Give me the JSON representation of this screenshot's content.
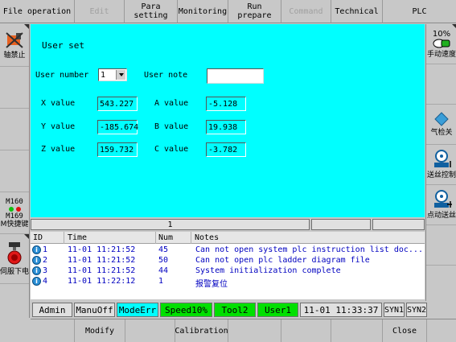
{
  "menu": {
    "file_operation": "File operation",
    "edit": "Edit",
    "para_setting_1": "Para",
    "para_setting_2": "setting",
    "monitoring": "Monitoring",
    "run_prepare": "Run prepare",
    "command": "Command",
    "technical": "Technical",
    "plc": "PLC"
  },
  "left_sidebar": {
    "axis_forbid": "轴禁止",
    "m160": "M160",
    "m169": "M169",
    "shortcut": "M快捷键",
    "servo_off": "伺服下电"
  },
  "right_sidebar": {
    "speed_percent": "10%",
    "manual_speed": "手动速度",
    "gas_check_off": "气检关",
    "wire_feed_control": "送丝控制",
    "inch_wire_feed": "点动送丝"
  },
  "panel": {
    "title": "User set",
    "user_number_label": "User number",
    "user_number_value": "1",
    "user_note_label": "User note",
    "user_note_value": "",
    "x_label": "X value",
    "x_value": "543.227",
    "y_label": "Y value",
    "y_value": "-185.674",
    "z_label": "Z value",
    "z_value": "159.732",
    "a_label": "A value",
    "a_value": "-5.128",
    "b_label": "B value",
    "b_value": "19.938",
    "c_label": "C value",
    "c_value": "-3.782"
  },
  "status_strip": {
    "page": "1"
  },
  "log": {
    "headers": {
      "id": "ID",
      "time": "Time",
      "num": "Num",
      "notes": "Notes"
    },
    "rows": [
      {
        "id": "1",
        "time": "11-01 11:21:52",
        "num": "45",
        "note": "Can not open system plc instruction list doc..."
      },
      {
        "id": "2",
        "time": "11-01 11:21:52",
        "num": "50",
        "note": "Can not open plc ladder diagram file"
      },
      {
        "id": "3",
        "time": "11-01 11:21:52",
        "num": "44",
        "note": "System initialization complete"
      },
      {
        "id": "4",
        "time": "11-01 11:22:12",
        "num": "1",
        "note": "报警复位"
      }
    ]
  },
  "status_bar": {
    "admin": "Admin",
    "manu_off": "ManuOff",
    "mode_err": "ModeErr",
    "speed": "Speed10%",
    "tool": "Tool2",
    "user": "User1",
    "clock": "11-01 11:33:37",
    "syn1": "SYN1",
    "syn2": "SYN2"
  },
  "bottom_buttons": {
    "modify": "Modify",
    "calibration": "Calibration",
    "close": "Close"
  },
  "colors": {
    "panel_bg": "#00ffff",
    "status_green": "#00e000",
    "status_cyan": "#00ffff",
    "log_text": "#0000c0",
    "bar_gray": "#c8c8c8"
  }
}
